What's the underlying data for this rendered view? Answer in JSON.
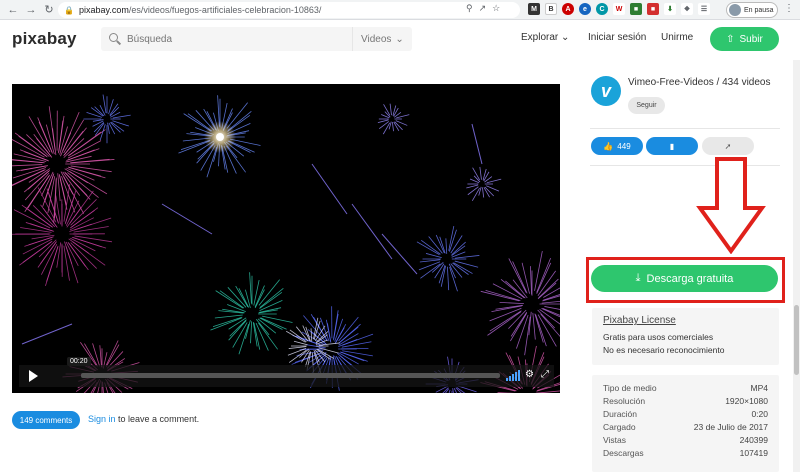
{
  "browser": {
    "url_host": "pixabay.com",
    "url_path": "/es/videos/fuegos-artificiales-celebracion-10863/",
    "profile_label": "En pausa"
  },
  "header": {
    "logo": "pixabay",
    "search_placeholder": "Búsqueda",
    "search_type": "Videos",
    "nav": [
      "Explorar",
      "Iniciar sesión",
      "Unirme"
    ],
    "upload_label": "Subir"
  },
  "player": {
    "time": "00:20",
    "progress": 0.0
  },
  "comments": {
    "count_label": "149 comments",
    "signin_link": "Sign in",
    "signin_suffix": " to leave a comment."
  },
  "sidebar": {
    "channel": "Vimeo-Free-Videos / 434 videos",
    "follow_label": "Seguir",
    "likes": "449",
    "download_label": "Descarga gratuita",
    "license_title": "Pixabay License",
    "license_lines": [
      "Gratis para usos comerciales",
      "No es necesario reconocimiento"
    ],
    "meta": [
      {
        "k": "Tipo de medio",
        "v": "MP4"
      },
      {
        "k": "Resolución",
        "v": "1920×1080"
      },
      {
        "k": "Duración",
        "v": "0:20"
      },
      {
        "k": "Cargado",
        "v": "23 de Julio de 2017"
      },
      {
        "k": "Vistas",
        "v": "240399"
      },
      {
        "k": "Descargas",
        "v": "107419"
      }
    ]
  },
  "colors": {
    "green": "#2ec66e",
    "blue": "#1a8ce0",
    "red": "#e0211b"
  }
}
